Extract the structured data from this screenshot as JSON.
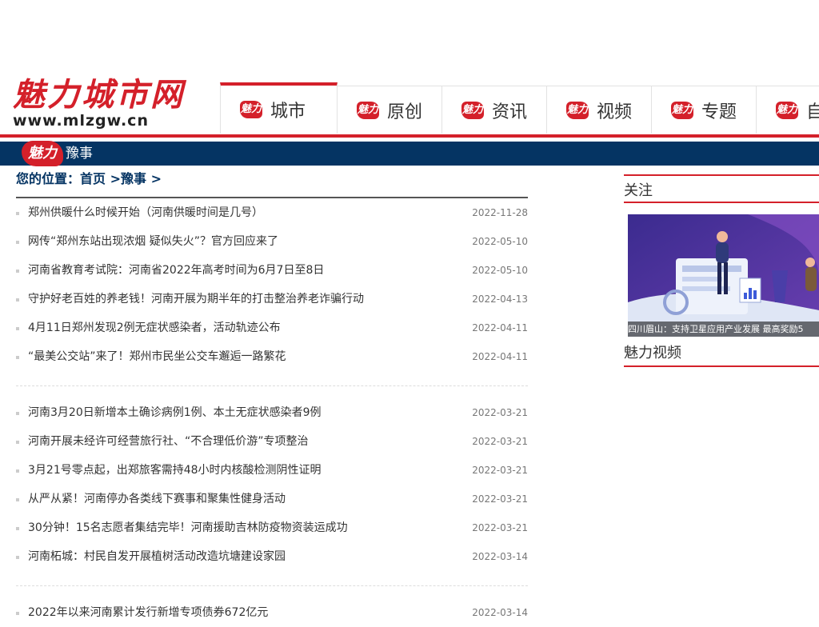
{
  "logo": {
    "name": "魅力城市网",
    "url": "www.mlzgw.cn"
  },
  "nav": {
    "badge": "魅力",
    "items": [
      {
        "label": "城市"
      },
      {
        "label": "原创"
      },
      {
        "label": "资讯"
      },
      {
        "label": "视频"
      },
      {
        "label": "专题"
      },
      {
        "label": "自"
      }
    ]
  },
  "section": {
    "badge": "魅力",
    "title": "豫事"
  },
  "breadcrumb": {
    "prefix": "您的位置：",
    "home": "首页",
    "sep1": " >",
    "current": "豫事",
    "sep2": " >"
  },
  "articles_group1": [
    {
      "title": "郑州供暖什么时候开始（河南供暖时间是几号）",
      "date": "2022-11-28"
    },
    {
      "title": "网传“郑州东站出现浓烟 疑似失火”？官方回应来了",
      "date": "2022-05-10"
    },
    {
      "title": "河南省教育考试院：河南省2022年高考时间为6月7日至8日",
      "date": "2022-05-10"
    },
    {
      "title": "守护好老百姓的养老钱！河南开展为期半年的打击整治养老诈骗行动",
      "date": "2022-04-13"
    },
    {
      "title": "4月11日郑州发现2例无症状感染者，活动轨迹公布",
      "date": "2022-04-11"
    },
    {
      "title": "“最美公交站”来了！郑州市民坐公交车邂逅一路繁花",
      "date": "2022-04-11"
    }
  ],
  "articles_group2": [
    {
      "title": "河南3月20日新增本土确诊病例1例、本土无症状感染者9例",
      "date": "2022-03-21"
    },
    {
      "title": "河南开展未经许可经营旅行社、“不合理低价游”专项整治",
      "date": "2022-03-21"
    },
    {
      "title": "3月21号零点起，出郑旅客需持48小时内核酸检测阴性证明",
      "date": "2022-03-21"
    },
    {
      "title": "从严从紧！河南停办各类线下赛事和聚集性健身活动",
      "date": "2022-03-21"
    },
    {
      "title": "30分钟！15名志愿者集结完毕！河南援助吉林防疫物资装运成功",
      "date": "2022-03-21"
    },
    {
      "title": "河南柘城：村民自发开展植树活动改造坑塘建设家园",
      "date": "2022-03-14"
    }
  ],
  "articles_group3": [
    {
      "title": "2022年以来河南累计发行新增专项债券672亿元",
      "date": "2022-03-14"
    }
  ],
  "sidebar": {
    "focus_title": "关注",
    "focus_caption": "四川眉山：支持卫星应用产业发展 最高奖励5",
    "video_title": "魅力视频"
  },
  "colors": {
    "brand_red": "#d4202a",
    "navy": "#053463"
  }
}
